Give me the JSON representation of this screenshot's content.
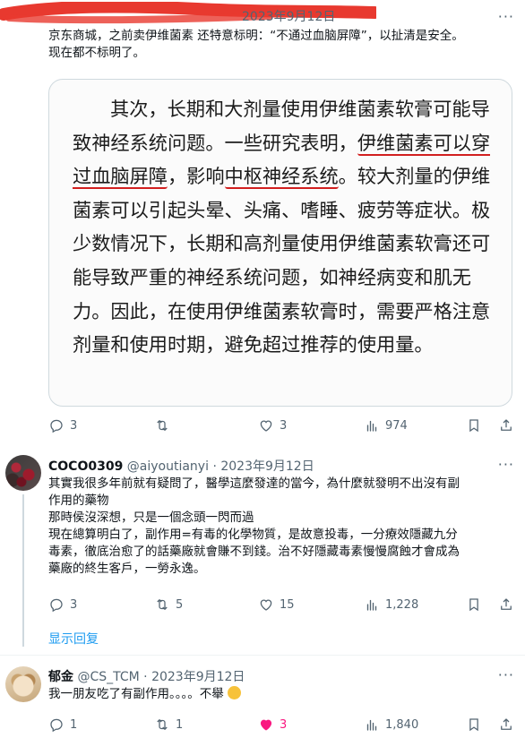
{
  "tweet1": {
    "header_partial": "2023年9月12日",
    "more": "···",
    "text_lines": [
      "京东商城，之前卖伊维菌素 还特意标明：“不通过血脑屏障”，以扯清是安全。",
      "现在都不标明了。"
    ],
    "image": {
      "p1": "其次，长期和大剂量使用伊维菌素软膏可能导致神经系统问题。一些研究表明，",
      "ul1": "伊维菌素可以穿过血脑屏障",
      "p2": "，影响",
      "ul2": "中枢神经系统",
      "p3": "。较大剂量的伊维菌素可以引起头晕、头痛、嗜睡、疲劳等症状。极少数情况下，长期和高剂量使用伊维菌素软膏还可能导致严重的神经系统问题，如神经病变和肌无力。因此，在使用伊维菌素软膏时，需要严格注意剂量和使用时期，避免超过推荐的使用量。"
    },
    "actions": {
      "reply": "3",
      "retweet": "",
      "like": "3",
      "views": "974"
    }
  },
  "tweet2": {
    "name": "COCO0309",
    "handle": "@aiyoutianyi",
    "sep": "·",
    "date": "2023年9月12日",
    "more": "···",
    "text_lines": [
      "其實我很多年前就有疑問了，醫學這麼發達的當今，為什麼就發明不出沒有副",
      "作用的藥物",
      "那時侯沒深想，只是一個念頭一閃而過",
      "現在總算明白了，副作用=有毒的化學物質，是故意投毒，一分療效隱藏九分",
      "毒素，徹底治愈了的話藥廠就會賺不到錢。治不好隱藏毒素慢慢腐蝕才會成為",
      "藥廠的終生客戶，一勞永逸。"
    ],
    "actions": {
      "reply": "3",
      "retweet": "5",
      "like": "15",
      "views": "1,228"
    },
    "show_replies": "显示回复"
  },
  "tweet3": {
    "name": "郁金",
    "handle": "@CS_TCM",
    "sep": "·",
    "date": "2023年9月12日",
    "more": "···",
    "text": "我一朋友吃了有副作用。。。。不舉",
    "actions": {
      "reply": "1",
      "retweet": "1",
      "like": "3",
      "views": "1,840"
    }
  }
}
